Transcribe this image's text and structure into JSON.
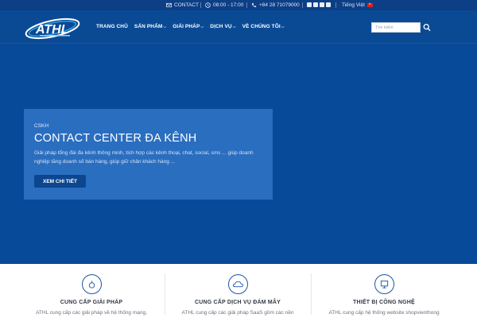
{
  "topbar": {
    "contact_label": "CONTACT",
    "hours": "08:00 - 17:00",
    "phone": "+84 28 71079000",
    "language": "Tiếng Việt",
    "social_icons": [
      "facebook-icon",
      "twitter-icon",
      "linkedin-icon",
      "youtube-icon"
    ]
  },
  "header": {
    "logo_text": "ATHL",
    "nav": [
      {
        "label": "TRANG CHỦ",
        "has_dropdown": false
      },
      {
        "label": "SẢN PHẨM",
        "has_dropdown": true
      },
      {
        "label": "GIẢI PHÁP",
        "has_dropdown": true
      },
      {
        "label": "DỊCH VỤ",
        "has_dropdown": true
      },
      {
        "label": "VỀ CHÚNG TÔI",
        "has_dropdown": true
      }
    ],
    "search_placeholder": "Tìm kiếm"
  },
  "hero": {
    "tag": "CSKH",
    "title": "CONTACT CENTER ĐA KÊNH",
    "description": "Giải pháp tổng đài đa kênh thông minh, tích hợp các kênh thoại, chat, social, sms ... giúp doanh nghiệp tăng doanh số bán hàng, giúp giữ chân khách hàng ...",
    "cta_label": "XEM CHI TIẾT"
  },
  "features": [
    {
      "title": "CUNG CẤP GIẢI PHÁP",
      "desc": "ATHL cung cấp các giải pháp về hệ thống mạng,",
      "icon": "network-icon"
    },
    {
      "title": "CUNG CẤP DỊCH VỤ ĐÁM MÂY",
      "desc": "ATHL cung cấp các giải pháp SaaS gồm các nền",
      "icon": "cloud-icon"
    },
    {
      "title": "THIẾT BỊ CÔNG NGHỆ",
      "desc": "ATHL cung cấp hệ thống website shopvienthong",
      "icon": "device-icon"
    }
  ],
  "colors": {
    "topbar_bg": "#0d3f86",
    "header_bg": "#0a4a95",
    "hero_bg": "#084a9a",
    "card_bg": "#2a6ec0",
    "cta_bg": "#0c468f"
  }
}
